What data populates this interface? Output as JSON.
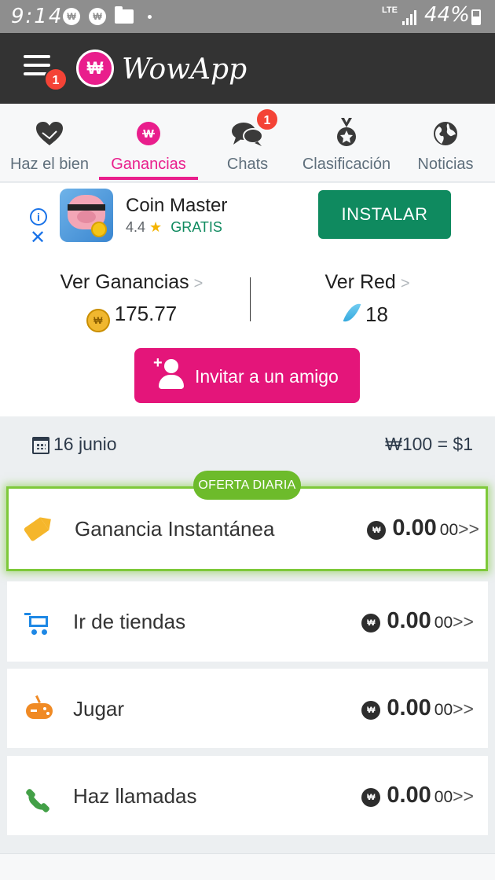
{
  "status_bar": {
    "time": "9:14",
    "network": "LTE",
    "battery": "44%"
  },
  "app_bar": {
    "title": "WowApp",
    "menu_badge": "1",
    "logo_glyph": "₩"
  },
  "tabs": [
    {
      "label": "Haz el bien",
      "icon": "heart-icon",
      "active": false
    },
    {
      "label": "Ganancias",
      "icon": "wowapp-coin-icon",
      "active": true
    },
    {
      "label": "Chats",
      "icon": "chat-bubbles-icon",
      "badge": "1",
      "active": false
    },
    {
      "label": "Clasificación",
      "icon": "medal-icon",
      "active": false
    },
    {
      "label": "Noticias",
      "icon": "globe-icon",
      "active": false
    }
  ],
  "ad": {
    "title": "Coin Master",
    "rating": "4.4",
    "price": "GRATIS",
    "install_label": "INSTALAR"
  },
  "earnings": {
    "title": "Ver Ganancias",
    "value": "175.77"
  },
  "network": {
    "title": "Ver Red",
    "value": "18"
  },
  "invite": {
    "label": "Invitar a un amigo"
  },
  "date_row": {
    "date": "16 junio",
    "rate": "₩100 = $1"
  },
  "offer_badge": "OFERTA DIARIA",
  "earning_items": [
    {
      "label": "Ganancia Instantánea",
      "amount": "0.00",
      "decimals": "00",
      "arrows": ">>",
      "icon": "tag-icon",
      "featured": true
    },
    {
      "label": "Ir de tiendas",
      "amount": "0.00",
      "decimals": "00",
      "arrows": ">>",
      "icon": "shopping-cart-icon",
      "featured": false
    },
    {
      "label": "Jugar",
      "amount": "0.00",
      "decimals": "00",
      "arrows": ">>",
      "icon": "gamepad-icon",
      "featured": false
    },
    {
      "label": "Haz llamadas",
      "amount": "0.00",
      "decimals": "00",
      "arrows": ">>",
      "icon": "phone-icon",
      "featured": false
    }
  ],
  "colors": {
    "brand_pink": "#e91e8c",
    "appbar": "#333333",
    "install_green": "#0f8a5f",
    "offer_green": "#6dbb2b"
  }
}
